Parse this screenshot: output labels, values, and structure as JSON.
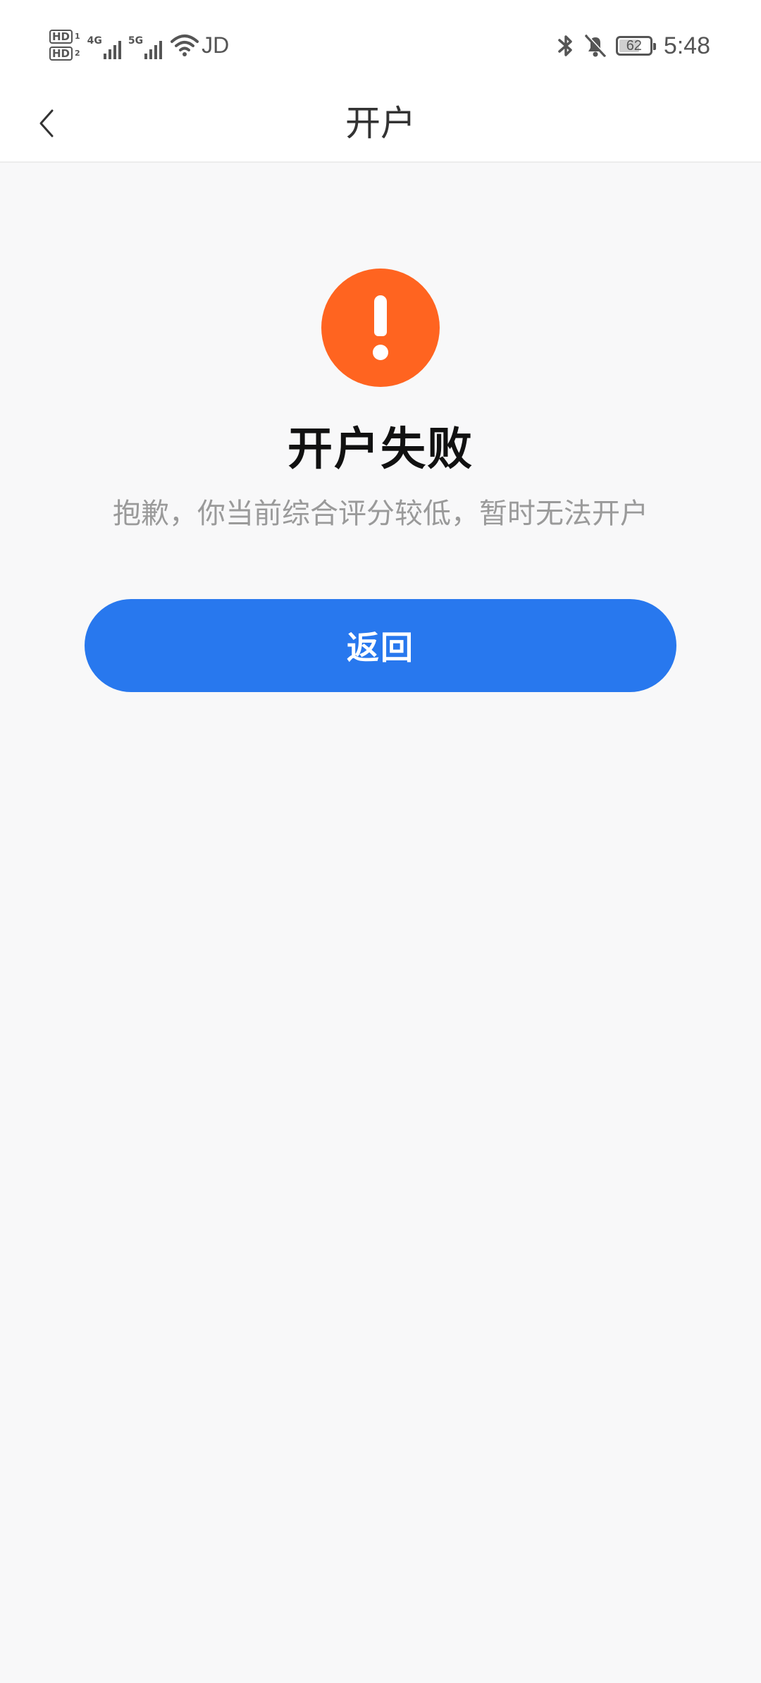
{
  "status_bar": {
    "sim1": "HD",
    "sim1_num": "1",
    "sim2": "HD",
    "sim2_num": "2",
    "net1": "4G",
    "net2": "5G",
    "carrier": "JD",
    "battery_percent": "62",
    "time": "5:48",
    "icons": [
      "bluetooth-icon",
      "bell-muted-icon"
    ]
  },
  "nav": {
    "title": "开户",
    "back_icon": "chevron-left-icon"
  },
  "result": {
    "icon": "exclamation-icon",
    "icon_color": "#ff6420",
    "title": "开户失败",
    "description": "抱歉，你当前综合评分较低，暂时无法开户"
  },
  "actions": {
    "return_label": "返回",
    "button_color": "#2878ee"
  }
}
